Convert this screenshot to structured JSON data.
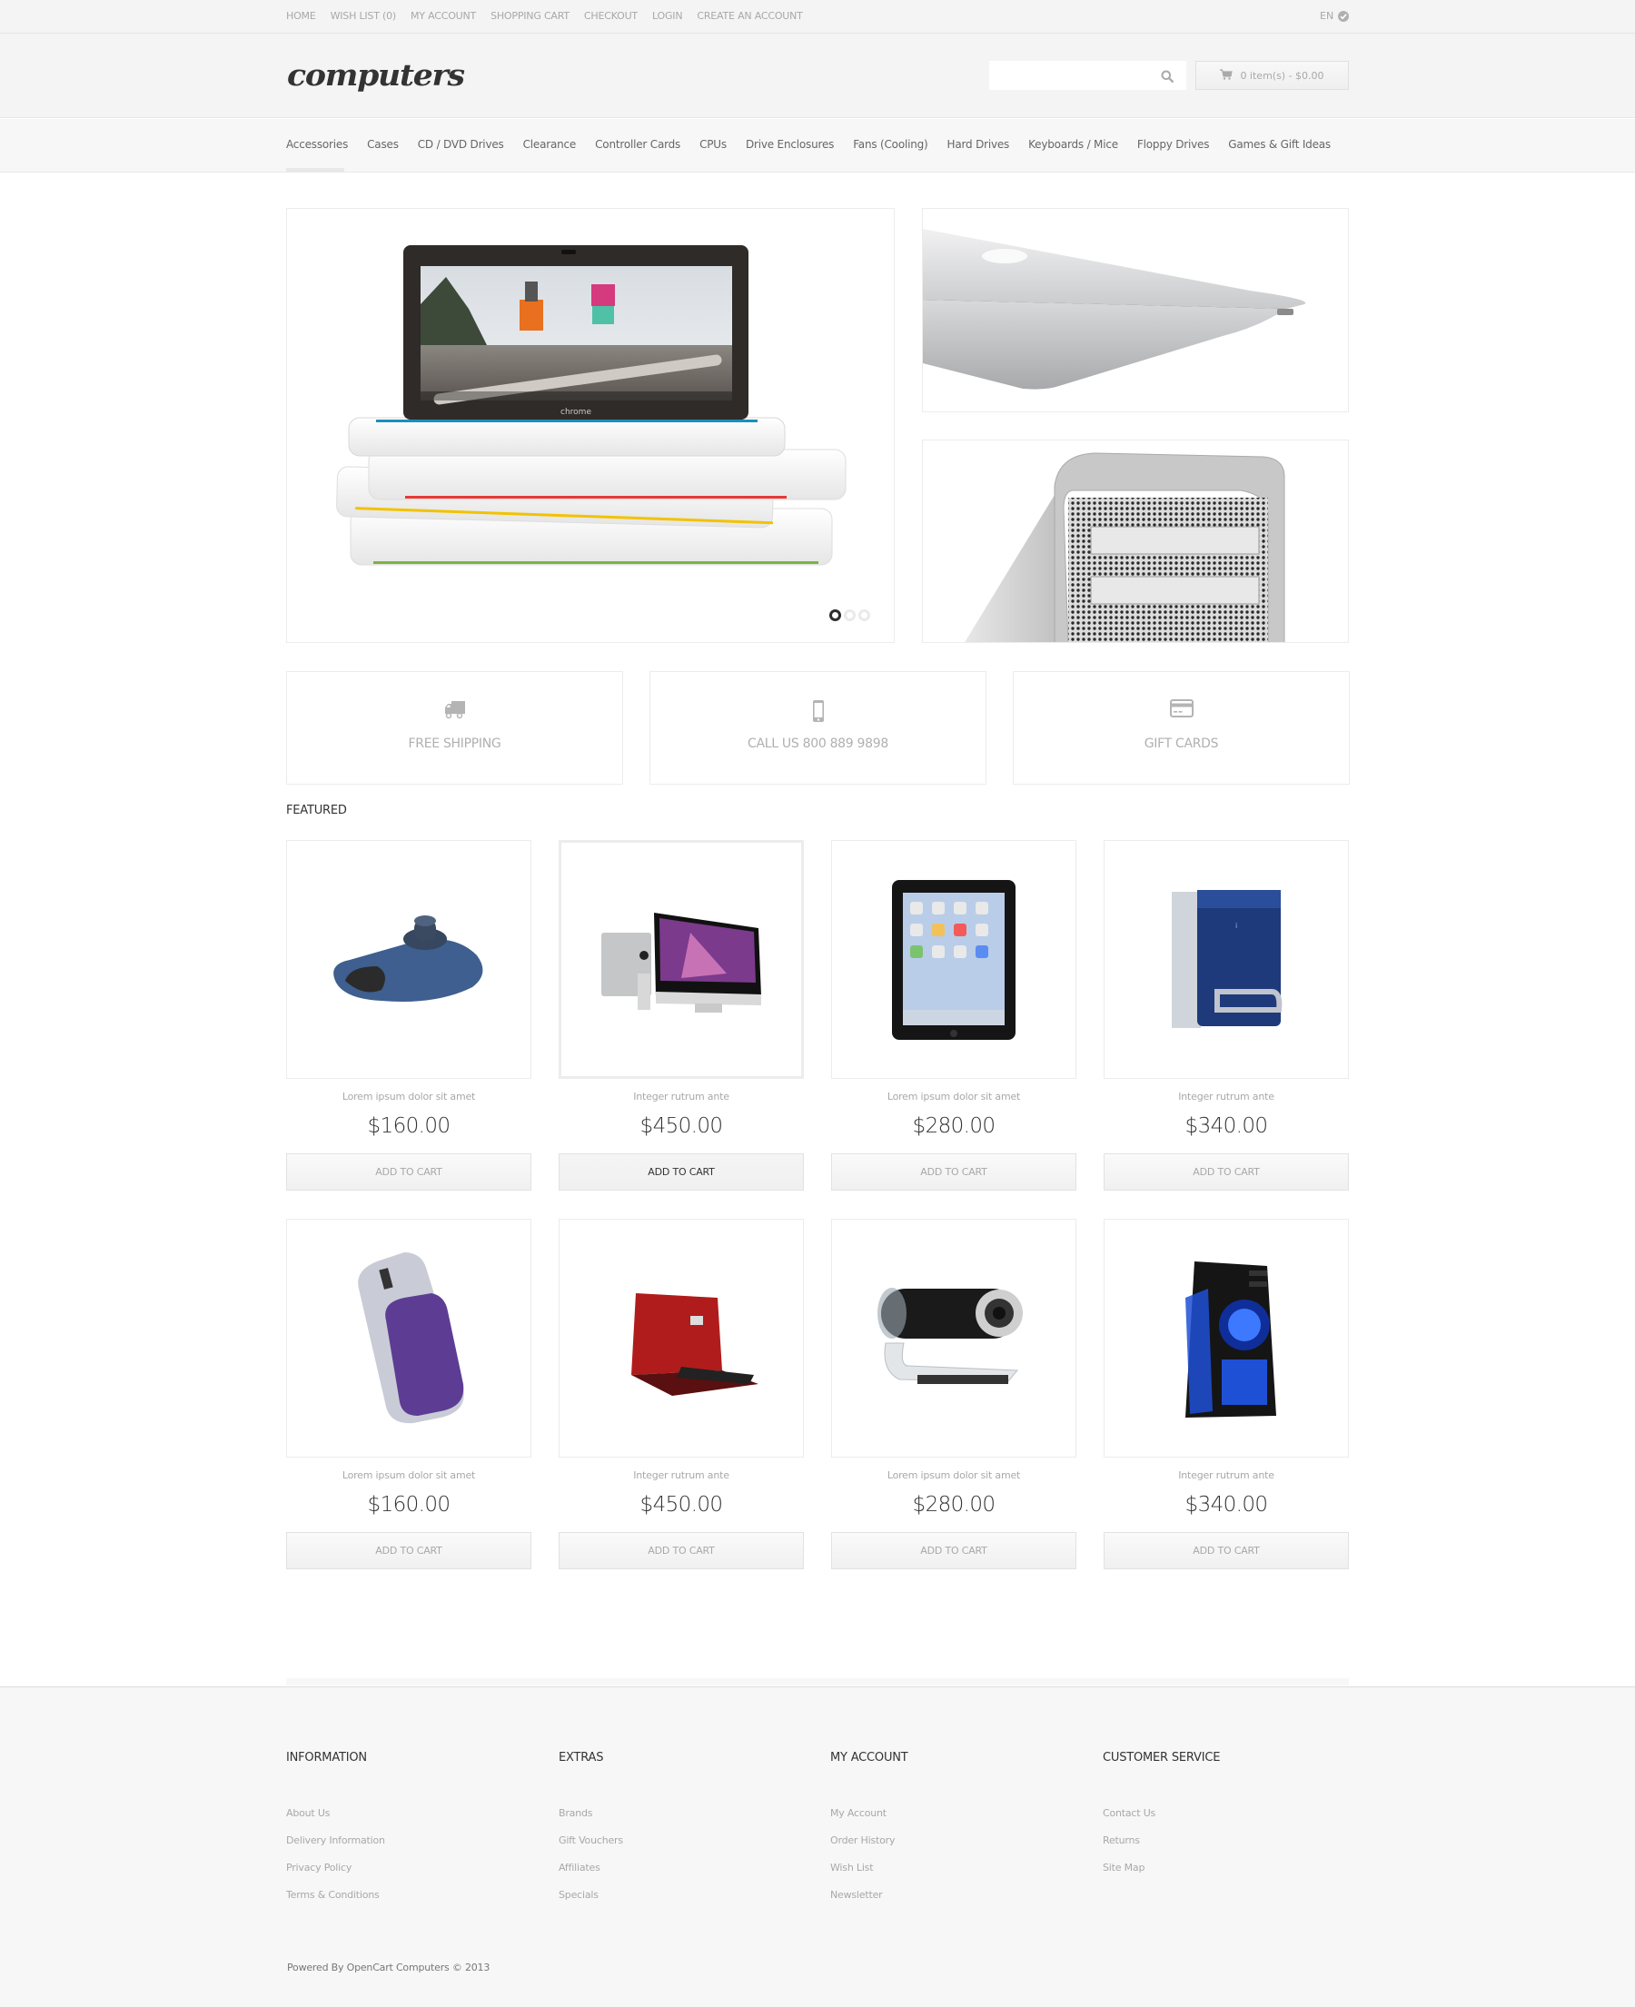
{
  "topbar": {
    "links": [
      "HOME",
      "WISH LIST (0)",
      "MY ACCOUNT",
      "SHOPPING CART",
      "CHECKOUT",
      "LOGIN",
      "CREATE AN ACCOUNT"
    ],
    "language": "EN"
  },
  "header": {
    "logo": "computers",
    "search": {
      "value": "",
      "placeholder": ""
    },
    "cart_label": "0 item(s) - $0.00"
  },
  "nav": {
    "items": [
      "Accessories",
      "Cases",
      "CD / DVD Drives",
      "Clearance",
      "Controller Cards",
      "CPUs",
      "Drive Enclosures",
      "Fans (Cooling)",
      "Hard Drives",
      "Keyboards / Mice",
      "Floppy Drives",
      "Games & Gift Ideas"
    ],
    "active_index": 0
  },
  "slider": {
    "screen_brand": "chrome",
    "slide_count": 3,
    "active_slide": 1
  },
  "info_boxes": [
    {
      "icon": "truck-icon",
      "label": "FREE SHIPPING"
    },
    {
      "icon": "phone-icon",
      "label": "CALL US  800 889 9898"
    },
    {
      "icon": "credit-card-icon",
      "label": "GIFT CARDS"
    }
  ],
  "featured": {
    "title": "FEATURED",
    "button_label": "ADD TO CART",
    "products": [
      {
        "name": "Lorem ipsum dolor sit amet",
        "price": "$160.00",
        "image": "3d-mouse"
      },
      {
        "name": "Integer rutrum ante",
        "price": "$450.00",
        "image": "imac",
        "hover": true
      },
      {
        "name": "Lorem ipsum dolor sit amet",
        "price": "$280.00",
        "image": "ipad"
      },
      {
        "name": "Integer rutrum ante",
        "price": "$340.00",
        "image": "external-drive"
      },
      {
        "name": "Lorem ipsum dolor sit amet",
        "price": "$160.00",
        "image": "vaio-mouse"
      },
      {
        "name": "Integer rutrum ante",
        "price": "$450.00",
        "image": "red-netbook"
      },
      {
        "name": "Lorem ipsum dolor sit amet",
        "price": "$280.00",
        "image": "webcam"
      },
      {
        "name": "Integer rutrum ante",
        "price": "$340.00",
        "image": "gaming-case"
      }
    ]
  },
  "footer": {
    "columns": [
      {
        "title": "INFORMATION",
        "links": [
          "About Us",
          "Delivery Information",
          "Privacy Policy",
          "Terms & Conditions"
        ]
      },
      {
        "title": "EXTRAS",
        "links": [
          "Brands",
          "Gift Vouchers",
          "Affiliates",
          "Specials"
        ]
      },
      {
        "title": "MY ACCOUNT",
        "links": [
          "My Account",
          "Order History",
          "Wish List",
          "Newsletter"
        ]
      },
      {
        "title": "CUSTOMER SERVICE",
        "links": [
          "Contact Us",
          "Returns",
          "Site Map"
        ]
      }
    ],
    "powered_by": "Powered By OpenCart Computers © 2013"
  },
  "colors": {
    "text_dark": "#333333",
    "text_muted": "#a8a8a8",
    "border": "#ececec",
    "band_bg": "#f4f4f4"
  }
}
